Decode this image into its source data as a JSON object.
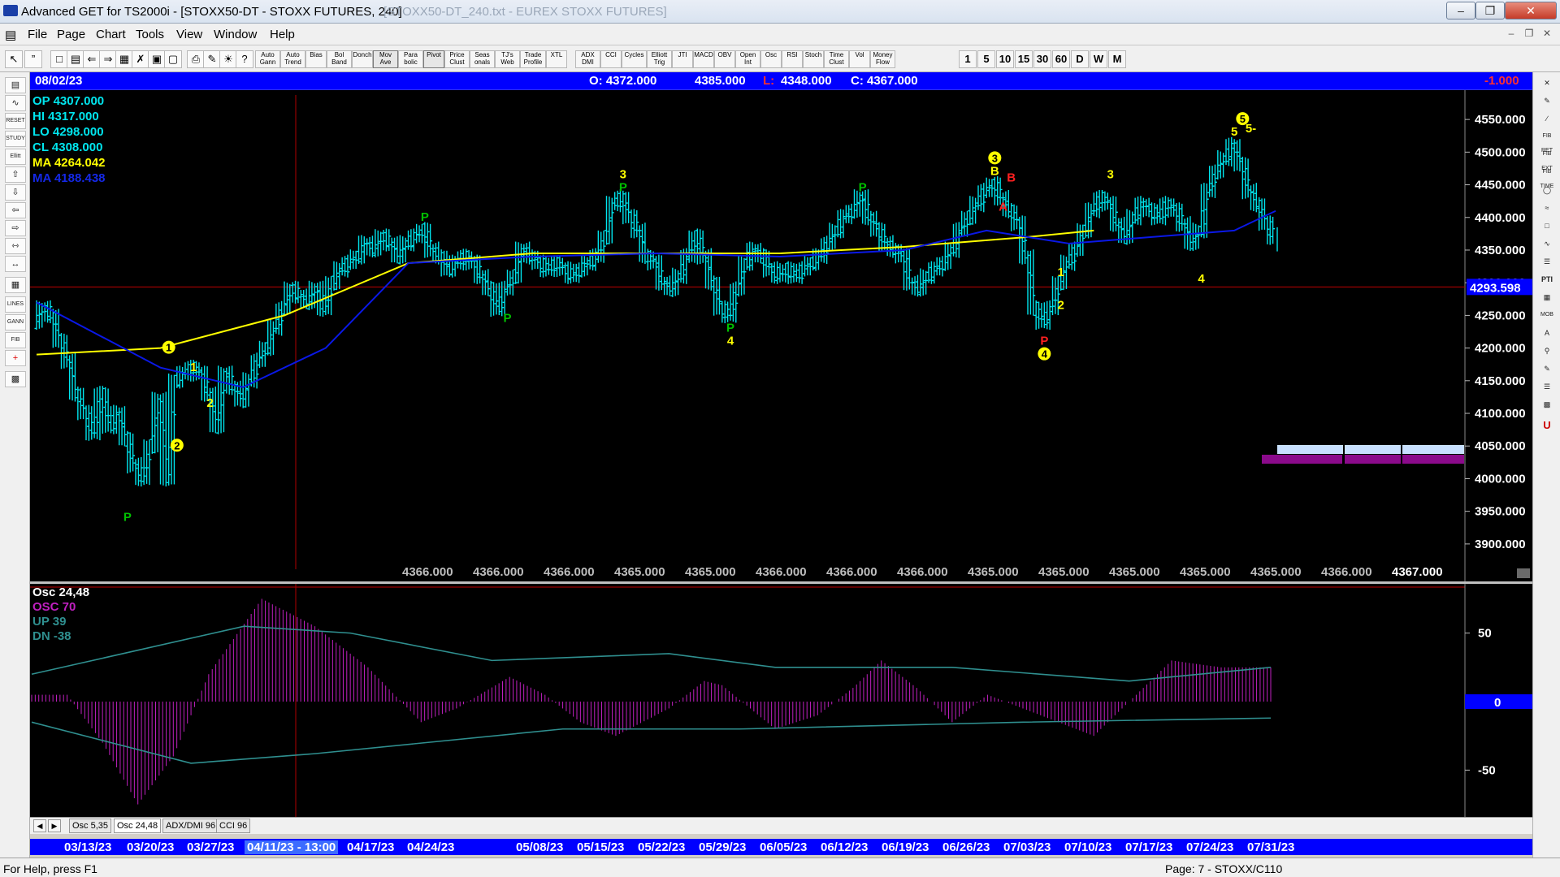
{
  "window": {
    "title": "Advanced GET for TS2000i - [STOXX50-DT - STOXX FUTURES, 240]",
    "ghost_title": "[STOXX50-DT_240.txt - EUREX STOXX FUTURES]"
  },
  "menu": [
    "File",
    "Page",
    "Chart",
    "Tools",
    "View",
    "Window",
    "Help"
  ],
  "toolbar": {
    "studies": [
      "Auto Gann",
      "Auto Trend",
      "Bias",
      "Bol Band",
      "Donch",
      "Mov Ave",
      "Para bolic",
      "Pivot",
      "Price Clust",
      "Seas onals",
      "TJ's Web",
      "Trade Profile",
      "XTL",
      "ADX DMI",
      "CCI",
      "Cycles",
      "Elliott Trig",
      "JTI",
      "MACD",
      "OBV",
      "Open Int",
      "Osc",
      "RSI",
      "Stoch",
      "Time Clust",
      "Vol",
      "Money Flow"
    ],
    "timeframes": [
      "1",
      "5",
      "10",
      "15",
      "30",
      "60",
      "D",
      "W",
      "M"
    ]
  },
  "left_tools": [
    "Ellitt",
    "RESET",
    "STUDY",
    "LINES",
    "GANN",
    "FIB"
  ],
  "right_tools": [
    "FIB RET",
    "FIB EXT",
    "FIB TIME",
    "PTI",
    "MOB"
  ],
  "header": {
    "date": "08/02/23",
    "open": "O: 4372.000",
    "high": "4385.000",
    "low_label": "L:",
    "low": "4348.000",
    "close": "C: 4367.000",
    "change": "-1.000"
  },
  "info": {
    "op": "OP  4307.000",
    "hi": "HI   4317.000",
    "lo": "LO  4298.000",
    "cl": "CL  4308.000",
    "ma1": "MA  4264.042",
    "ma2": "MA  4188.438"
  },
  "chart_data": [
    {
      "type": "candlestick",
      "title": "STOXX50-DT - STOXX FUTURES, 240",
      "y_ticks": [
        "4550.000",
        "4500.000",
        "4450.000",
        "4400.000",
        "4350.000",
        "4300.000",
        "4250.000",
        "4200.000",
        "4150.000",
        "4100.000",
        "4050.000",
        "4000.000",
        "3950.000",
        "3900.000"
      ],
      "ylim": [
        3870,
        4580
      ],
      "price_marker": "4293.598",
      "price_marker_value": 4293.598,
      "bottom_values": [
        "4366.000",
        "4366.000",
        "4366.000",
        "4365.000",
        "4365.000",
        "4366.000",
        "4366.000",
        "4366.000",
        "4365.000",
        "4365.000",
        "4365.000",
        "4365.000",
        "4365.000",
        "4366.000",
        "4367.000"
      ],
      "series": [
        {
          "name": "Price",
          "color": "#00e5ee"
        },
        {
          "name": "MA 4264.042",
          "color": "#ffff00"
        },
        {
          "name": "MA 4188.438",
          "color": "#0a18e6"
        }
      ],
      "price_path": [
        [
          0,
          4240
        ],
        [
          1,
          4260
        ],
        [
          2,
          4250
        ],
        [
          3,
          4210
        ],
        [
          4,
          4180
        ],
        [
          5,
          4130
        ],
        [
          6,
          4100
        ],
        [
          7,
          4070
        ],
        [
          8,
          4130
        ],
        [
          9,
          4080
        ],
        [
          10,
          4100
        ],
        [
          11,
          4060
        ],
        [
          12,
          4020
        ],
        [
          13,
          4000
        ],
        [
          14,
          4050
        ],
        [
          15,
          4120
        ],
        [
          16,
          4000
        ],
        [
          17,
          4150
        ],
        [
          18,
          4160
        ],
        [
          19,
          4170
        ],
        [
          20,
          4160
        ],
        [
          21,
          4130
        ],
        [
          22,
          4080
        ],
        [
          23,
          4160
        ],
        [
          24,
          4140
        ],
        [
          25,
          4120
        ],
        [
          26,
          4150
        ],
        [
          27,
          4180
        ],
        [
          28,
          4200
        ],
        [
          29,
          4230
        ],
        [
          30,
          4260
        ],
        [
          31,
          4290
        ],
        [
          32,
          4280
        ],
        [
          33,
          4270
        ],
        [
          34,
          4290
        ],
        [
          35,
          4260
        ],
        [
          36,
          4300
        ],
        [
          37,
          4320
        ],
        [
          38,
          4330
        ],
        [
          39,
          4340
        ],
        [
          40,
          4360
        ],
        [
          41,
          4350
        ],
        [
          42,
          4370
        ],
        [
          43,
          4360
        ],
        [
          44,
          4340
        ],
        [
          45,
          4360
        ],
        [
          46,
          4370
        ],
        [
          47,
          4380
        ],
        [
          48,
          4350
        ],
        [
          49,
          4340
        ],
        [
          50,
          4320
        ],
        [
          51,
          4330
        ],
        [
          52,
          4340
        ],
        [
          53,
          4330
        ],
        [
          54,
          4310
        ],
        [
          55,
          4290
        ],
        [
          56,
          4260
        ],
        [
          57,
          4290
        ],
        [
          58,
          4310
        ],
        [
          59,
          4350
        ],
        [
          60,
          4340
        ],
        [
          61,
          4330
        ],
        [
          62,
          4320
        ],
        [
          63,
          4330
        ],
        [
          64,
          4320
        ],
        [
          65,
          4310
        ],
        [
          66,
          4320
        ],
        [
          67,
          4330
        ],
        [
          68,
          4340
        ],
        [
          69,
          4370
        ],
        [
          70,
          4420
        ],
        [
          71,
          4430
        ],
        [
          72,
          4400
        ],
        [
          73,
          4380
        ],
        [
          74,
          4340
        ],
        [
          75,
          4330
        ],
        [
          76,
          4300
        ],
        [
          77,
          4290
        ],
        [
          78,
          4310
        ],
        [
          79,
          4340
        ],
        [
          80,
          4370
        ],
        [
          81,
          4340
        ],
        [
          82,
          4300
        ],
        [
          83,
          4260
        ],
        [
          84,
          4250
        ],
        [
          85,
          4290
        ],
        [
          86,
          4330
        ],
        [
          87,
          4350
        ],
        [
          88,
          4340
        ],
        [
          89,
          4320
        ],
        [
          90,
          4310
        ],
        [
          91,
          4320
        ],
        [
          92,
          4310
        ],
        [
          93,
          4320
        ],
        [
          94,
          4330
        ],
        [
          95,
          4340
        ],
        [
          96,
          4360
        ],
        [
          97,
          4380
        ],
        [
          98,
          4400
        ],
        [
          99,
          4410
        ],
        [
          100,
          4430
        ],
        [
          101,
          4400
        ],
        [
          102,
          4380
        ],
        [
          103,
          4360
        ],
        [
          104,
          4350
        ],
        [
          105,
          4340
        ],
        [
          106,
          4300
        ],
        [
          107,
          4290
        ],
        [
          108,
          4310
        ],
        [
          109,
          4320
        ],
        [
          110,
          4330
        ],
        [
          111,
          4350
        ],
        [
          112,
          4380
        ],
        [
          113,
          4400
        ],
        [
          114,
          4420
        ],
        [
          115,
          4440
        ],
        [
          116,
          4450
        ],
        [
          117,
          4430
        ],
        [
          118,
          4410
        ],
        [
          119,
          4390
        ],
        [
          120,
          4340
        ],
        [
          121,
          4260
        ],
        [
          122,
          4240
        ],
        [
          123,
          4260
        ],
        [
          124,
          4300
        ],
        [
          125,
          4330
        ],
        [
          126,
          4350
        ],
        [
          127,
          4380
        ],
        [
          128,
          4410
        ],
        [
          129,
          4430
        ],
        [
          130,
          4420
        ],
        [
          131,
          4390
        ],
        [
          132,
          4370
        ],
        [
          133,
          4400
        ],
        [
          134,
          4420
        ],
        [
          135,
          4410
        ],
        [
          136,
          4400
        ],
        [
          137,
          4420
        ],
        [
          138,
          4410
        ],
        [
          139,
          4390
        ],
        [
          140,
          4360
        ],
        [
          141,
          4380
        ],
        [
          142,
          4440
        ],
        [
          143,
          4470
        ],
        [
          144,
          4490
        ],
        [
          145,
          4510
        ],
        [
          146,
          4480
        ],
        [
          147,
          4440
        ],
        [
          148,
          4420
        ],
        [
          149,
          4390
        ],
        [
          150,
          4370
        ]
      ],
      "ma1_path": [
        [
          0,
          4190
        ],
        [
          15,
          4200
        ],
        [
          30,
          4250
        ],
        [
          45,
          4330
        ],
        [
          60,
          4345
        ],
        [
          75,
          4345
        ],
        [
          90,
          4345
        ],
        [
          105,
          4355
        ],
        [
          120,
          4370
        ],
        [
          128,
          4380
        ]
      ],
      "ma2_path": [
        [
          0,
          4270
        ],
        [
          15,
          4170
        ],
        [
          25,
          4140
        ],
        [
          35,
          4200
        ],
        [
          45,
          4330
        ],
        [
          60,
          4340
        ],
        [
          75,
          4345
        ],
        [
          90,
          4340
        ],
        [
          105,
          4350
        ],
        [
          115,
          4380
        ],
        [
          125,
          4360
        ],
        [
          135,
          4370
        ],
        [
          145,
          4380
        ],
        [
          150,
          4410
        ]
      ],
      "wave_labels": [
        {
          "text": "P",
          "color": "#00c000",
          "i": 11,
          "y": 3935
        },
        {
          "text": "2",
          "color": "#ffff00",
          "circle": true,
          "i": 17,
          "y": 4045
        },
        {
          "text": "1",
          "color": "#ffff00",
          "circle": true,
          "i": 16,
          "y": 4195
        },
        {
          "text": "1",
          "color": "#ffff00",
          "i": 19,
          "y": 4165
        },
        {
          "text": "2",
          "color": "#ffff00",
          "i": 21,
          "y": 4110
        },
        {
          "text": "P",
          "color": "#00c000",
          "i": 47,
          "y": 4395
        },
        {
          "text": "P",
          "color": "#00c000",
          "i": 57,
          "y": 4240
        },
        {
          "text": "3",
          "color": "#ffff00",
          "i": 71,
          "y": 4460
        },
        {
          "text": "P",
          "color": "#00c000",
          "i": 71,
          "y": 4440
        },
        {
          "text": "P",
          "color": "#00c000",
          "i": 84,
          "y": 4225
        },
        {
          "text": "4",
          "color": "#ffff00",
          "i": 84,
          "y": 4205
        },
        {
          "text": "P",
          "color": "#00c000",
          "i": 100,
          "y": 4440
        },
        {
          "text": "3",
          "color": "#ffff00",
          "circle": true,
          "i": 116,
          "y": 4485
        },
        {
          "text": "B",
          "color": "#ffff00",
          "i": 116,
          "y": 4465
        },
        {
          "text": "B",
          "color": "#ff2020",
          "i": 118,
          "y": 4455
        },
        {
          "text": "A",
          "color": "#ff2020",
          "i": 117,
          "y": 4410
        },
        {
          "text": "P",
          "color": "#ff2020",
          "i": 122,
          "y": 4205
        },
        {
          "text": "4",
          "color": "#ffff00",
          "circle": true,
          "i": 122,
          "y": 4185
        },
        {
          "text": "1",
          "color": "#ffff00",
          "i": 124,
          "y": 4310
        },
        {
          "text": "2",
          "color": "#ffff00",
          "i": 124,
          "y": 4260
        },
        {
          "text": "3",
          "color": "#ffff00",
          "i": 130,
          "y": 4460
        },
        {
          "text": "4",
          "color": "#ffff00",
          "i": 141,
          "y": 4300
        },
        {
          "text": "5",
          "color": "#ffff00",
          "circle": true,
          "i": 146,
          "y": 4545
        },
        {
          "text": "5",
          "color": "#ffff00",
          "i": 145,
          "y": 4525
        },
        {
          "text": "5-",
          "color": "#ffff00",
          "i": 147,
          "y": 4530
        }
      ]
    },
    {
      "type": "bar",
      "title": "Osc 24,48",
      "legend": [
        "Osc 24,48",
        "OSC 70",
        "UP  39",
        "DN  -38"
      ],
      "y_ticks": [
        "50",
        "0",
        "-50"
      ],
      "ylim": [
        -80,
        80
      ],
      "zero_marker": "0",
      "osc_points": [
        [
          0,
          5
        ],
        [
          10,
          5
        ],
        [
          20,
          -30
        ],
        [
          30,
          -75
        ],
        [
          40,
          -40
        ],
        [
          50,
          20
        ],
        [
          65,
          75
        ],
        [
          80,
          55
        ],
        [
          95,
          25
        ],
        [
          110,
          -15
        ],
        [
          120,
          -5
        ],
        [
          135,
          18
        ],
        [
          145,
          5
        ],
        [
          155,
          -15
        ],
        [
          165,
          -25
        ],
        [
          180,
          -5
        ],
        [
          190,
          15
        ],
        [
          195,
          12
        ],
        [
          210,
          -20
        ],
        [
          222,
          -10
        ],
        [
          232,
          10
        ],
        [
          240,
          30
        ],
        [
          250,
          10
        ],
        [
          260,
          -15
        ],
        [
          270,
          5
        ],
        [
          285,
          -10
        ],
        [
          300,
          -25
        ],
        [
          310,
          0
        ],
        [
          322,
          30
        ],
        [
          336,
          25
        ],
        [
          350,
          25
        ]
      ],
      "up_points": [
        [
          0,
          20
        ],
        [
          60,
          55
        ],
        [
          90,
          50
        ],
        [
          130,
          30
        ],
        [
          180,
          35
        ],
        [
          210,
          25
        ],
        [
          260,
          25
        ],
        [
          310,
          15
        ],
        [
          350,
          25
        ]
      ],
      "dn_points": [
        [
          0,
          -15
        ],
        [
          45,
          -45
        ],
        [
          80,
          -38
        ],
        [
          150,
          -20
        ],
        [
          200,
          -20
        ],
        [
          280,
          -15
        ],
        [
          350,
          -12
        ]
      ]
    }
  ],
  "tabs": [
    "Osc 5,35",
    "Osc 24,48",
    "ADX/DMI 96",
    "CCI 96"
  ],
  "dates": [
    "03/13/23",
    "03/20/23",
    "03/27/23",
    "04/11/23 - 13:00",
    "04/17/23",
    "04/24/23",
    "05/08/23",
    "05/15/23",
    "05/22/23",
    "05/29/23",
    "06/05/23",
    "06/12/23",
    "06/19/23",
    "06/26/23",
    "07/03/23",
    "07/10/23",
    "07/17/23",
    "07/24/23",
    "07/31/23"
  ],
  "status": {
    "left": "For Help, press F1",
    "right": "Page: 7 - STOXX/C110"
  },
  "colors": {
    "price": "#00e5ee",
    "ma_yellow": "#ffff00",
    "ma_blue": "#0a18e6",
    "osc": "#c020c0",
    "band": "#2f8f8f",
    "marker_red": "#c00000"
  }
}
